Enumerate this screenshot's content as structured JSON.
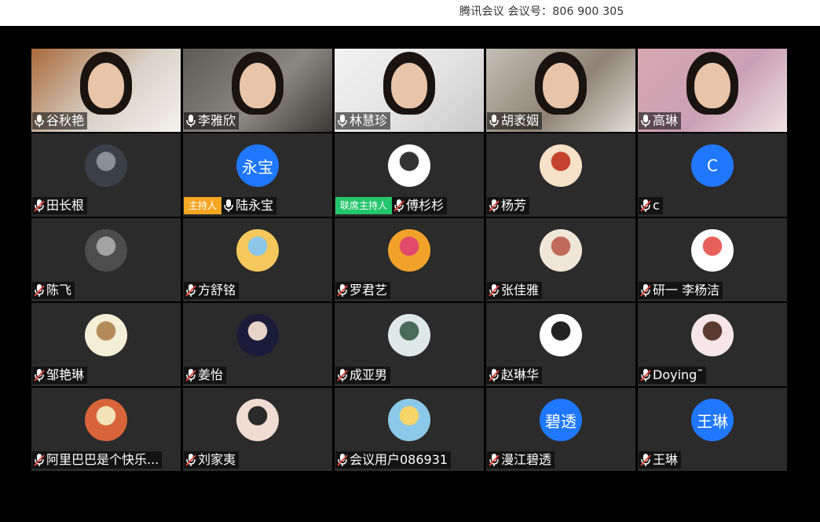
{
  "window": {
    "title": "腾讯会议 会议号：806 900 305"
  },
  "participants": [
    {
      "name": "谷秋艳",
      "mode": "video",
      "mic": "on",
      "colors": [
        "#a86a3c",
        "#d9d2c8",
        "#f4f1ec"
      ]
    },
    {
      "name": "李雅欣",
      "mode": "video",
      "mic": "on",
      "colors": [
        "#5c5a55",
        "#8b8782",
        "#3b3835"
      ]
    },
    {
      "name": "林慧珍",
      "mode": "video",
      "mic": "on",
      "colors": [
        "#f2f2f2",
        "#e3e3e3",
        "#c9c9c9"
      ]
    },
    {
      "name": "胡袤姻",
      "mode": "video",
      "mic": "on",
      "colors": [
        "#c4bfb5",
        "#8f8376",
        "#e2ddd4"
      ]
    },
    {
      "name": "高琳",
      "mode": "video",
      "mic": "on",
      "colors": [
        "#d8a7b1",
        "#caa1b4",
        "#efe2e4"
      ]
    },
    {
      "name": "田长根",
      "mode": "avatar",
      "mic": "muted",
      "avatar_type": "photo",
      "avatar_colors": [
        "#3a3f48",
        "#8a8f98"
      ]
    },
    {
      "name": "陆永宝",
      "mode": "avatar",
      "mic": "on",
      "badge": "主持人",
      "badge_type": "host",
      "avatar_type": "text",
      "avatar_text": "永宝"
    },
    {
      "name": "傅杉杉",
      "mode": "avatar",
      "mic": "muted",
      "badge": "联席主持人",
      "badge_type": "cohost",
      "avatar_type": "photo",
      "avatar_colors": [
        "#ffffff",
        "#333333"
      ]
    },
    {
      "name": "杨芳",
      "mode": "avatar",
      "mic": "muted",
      "avatar_type": "photo",
      "avatar_colors": [
        "#f7e1c8",
        "#c4432f"
      ]
    },
    {
      "name": "c",
      "mode": "avatar",
      "mic": "muted",
      "avatar_type": "text",
      "avatar_text": "C"
    },
    {
      "name": "陈飞",
      "mode": "avatar",
      "mic": "muted",
      "avatar_type": "photo",
      "avatar_colors": [
        "#4d4d4d",
        "#a3a3a3"
      ]
    },
    {
      "name": "方舒铭",
      "mode": "avatar",
      "mic": "muted",
      "avatar_type": "photo",
      "avatar_colors": [
        "#f4c85c",
        "#8cc7e8"
      ]
    },
    {
      "name": "罗君艺",
      "mode": "avatar",
      "mic": "muted",
      "avatar_type": "photo",
      "avatar_colors": [
        "#f0a22b",
        "#e24a6b"
      ]
    },
    {
      "name": "张佳雅",
      "mode": "avatar",
      "mic": "muted",
      "avatar_type": "photo",
      "avatar_colors": [
        "#f0e6d8",
        "#c06a5c"
      ]
    },
    {
      "name": "研一 李杨洁",
      "mode": "avatar",
      "mic": "muted",
      "avatar_type": "photo",
      "avatar_colors": [
        "#ffffff",
        "#e8605a"
      ]
    },
    {
      "name": "邹艳琳",
      "mode": "avatar",
      "mic": "muted",
      "avatar_type": "photo",
      "avatar_colors": [
        "#f3efd6",
        "#b58a5a"
      ]
    },
    {
      "name": "姜怡",
      "mode": "avatar",
      "mic": "muted",
      "avatar_type": "photo",
      "avatar_colors": [
        "#1b1b3a",
        "#e8d3c8"
      ]
    },
    {
      "name": "成亚男",
      "mode": "avatar",
      "mic": "muted",
      "avatar_type": "photo",
      "avatar_colors": [
        "#dfe8e8",
        "#4a6a5a"
      ]
    },
    {
      "name": "赵琳华",
      "mode": "avatar",
      "mic": "muted",
      "avatar_type": "photo",
      "avatar_colors": [
        "#ffffff",
        "#222222"
      ]
    },
    {
      "name": "Doying˜",
      "mode": "avatar",
      "mic": "muted",
      "avatar_type": "photo",
      "avatar_colors": [
        "#f7e6e8",
        "#5a3a2e"
      ]
    },
    {
      "name": "阿里巴巴是个快乐...",
      "mode": "avatar",
      "mic": "muted",
      "avatar_type": "photo",
      "avatar_colors": [
        "#d7643a",
        "#f3e2b8"
      ]
    },
    {
      "name": "刘家夷",
      "mode": "avatar",
      "mic": "muted",
      "avatar_type": "photo",
      "avatar_colors": [
        "#f0dcd2",
        "#2a2a2a"
      ]
    },
    {
      "name": "会议用户086931",
      "mode": "avatar",
      "mic": "muted",
      "avatar_type": "photo",
      "avatar_colors": [
        "#8cc9e8",
        "#f6d56a"
      ]
    },
    {
      "name": "漫江碧透",
      "mode": "avatar",
      "mic": "muted",
      "avatar_type": "text",
      "avatar_text": "碧透"
    },
    {
      "name": "王琳",
      "mode": "avatar",
      "mic": "muted",
      "avatar_type": "text",
      "avatar_text": "王琳"
    }
  ],
  "colors": {
    "avatar_blue": "#1f78ff",
    "host_badge": "#f5a623",
    "cohost_badge": "#23c56a",
    "muted_slash": "#e2463a",
    "tile_bg": "#2b2b2b"
  },
  "icons": {
    "mic_on": "mic-icon",
    "mic_muted": "mic-muted-icon"
  }
}
